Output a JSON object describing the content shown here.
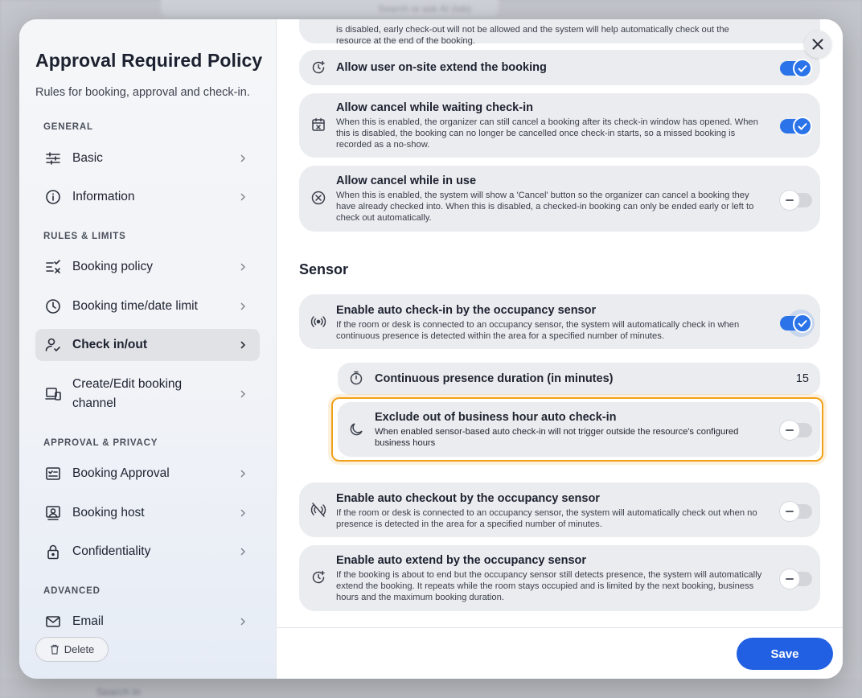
{
  "background": {
    "search_placeholder": "Search or ask AI (tab)",
    "bottom_text": "Search in"
  },
  "sidebar": {
    "title": "Approval Required Policy",
    "subtitle": "Rules for booking, approval and check-in.",
    "sections": {
      "general": "GENERAL",
      "rules": "RULES & LIMITS",
      "approval": "APPROVAL & PRIVACY",
      "advanced": "ADVANCED"
    },
    "items": [
      {
        "label": "Basic",
        "icon": "sliders-icon"
      },
      {
        "label": "Information",
        "icon": "info-icon"
      },
      {
        "label": "Booking policy",
        "icon": "checklist-icon"
      },
      {
        "label": "Booking time/date limit",
        "icon": "clock-icon"
      },
      {
        "label": "Check in/out",
        "icon": "user-check-icon"
      },
      {
        "label": "Create/Edit booking channel",
        "icon": "devices-icon"
      },
      {
        "label": "Booking Approval",
        "icon": "approval-icon"
      },
      {
        "label": "Booking host",
        "icon": "host-icon"
      },
      {
        "label": "Confidentiality",
        "icon": "lock-icon"
      },
      {
        "label": "Email",
        "icon": "mail-icon"
      }
    ],
    "delete_label": "Delete"
  },
  "main": {
    "top_fragment": "is disabled, early check-out will not be allowed and the system will help automatically check out the resource at the end of the booking.",
    "settings": [
      {
        "title": "Allow user on-site extend the booking",
        "desc": "",
        "enabled": true
      },
      {
        "title": "Allow cancel while waiting check-in",
        "desc": "When this is enabled, the organizer can still cancel a booking after its check-in window has opened. When this is disabled, the booking can no longer be cancelled once check-in starts, so a missed booking is recorded as a no-show.",
        "enabled": true
      },
      {
        "title": "Allow cancel while in use",
        "desc": "When this is enabled, the system will show a 'Cancel' button so the organizer can cancel a booking they have already checked into. When this is disabled, a checked-in booking can only be ended early or left to check out automatically.",
        "enabled": false
      }
    ],
    "sensor_title": "Sensor",
    "sensor_settings": [
      {
        "title": "Enable auto check-in by the occupancy sensor",
        "desc": "If the room or desk is connected to an occupancy sensor, the system will automatically check in when continuous presence is detected within the area for a specified number of minutes.",
        "enabled": true
      },
      {
        "title": "Enable auto checkout by the occupancy sensor",
        "desc": "If the room or desk is connected to an occupancy sensor, the system will automatically check out when no presence is detected in the area for a specified number of minutes.",
        "enabled": false
      },
      {
        "title": "Enable auto extend by the occupancy sensor",
        "desc": "If the booking is about to end but the occupancy sensor still detects presence, the system will automatically extend the booking. It repeats while the room stays occupied and is limited by the next booking, business hours and the maximum booking duration.",
        "enabled": false
      }
    ],
    "duration": {
      "label": "Continuous presence duration (in minutes)",
      "value": "15"
    },
    "exclude": {
      "title": "Exclude out of business hour auto check-in",
      "desc": "When enabled sensor-based auto check-in will not trigger outside the resource's configured business hours",
      "enabled": false
    }
  },
  "footer": {
    "save_label": "Save"
  },
  "colors": {
    "accent": "#2160e3",
    "toggle_on": "#2a73e8",
    "highlight": "#f0a11a"
  }
}
